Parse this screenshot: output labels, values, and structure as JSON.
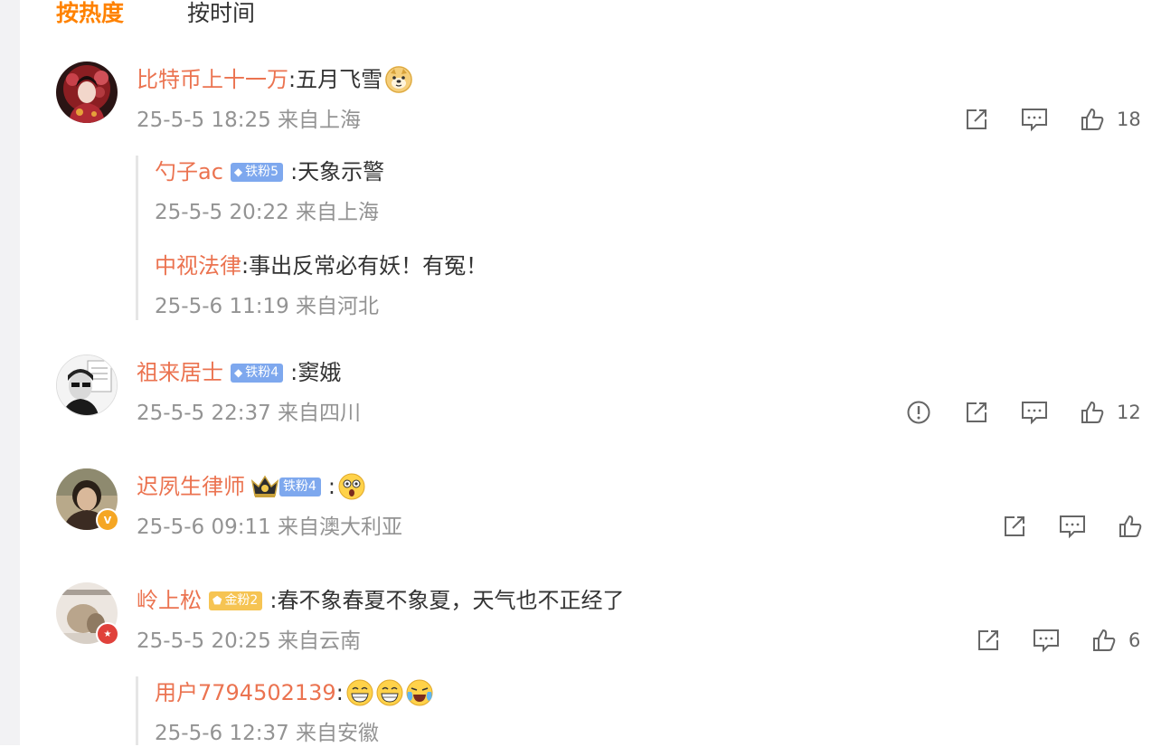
{
  "sort_tabs": {
    "hot": "按热度",
    "time": "按时间"
  },
  "colors": {
    "accent": "#ff8200",
    "username": "#eb7350",
    "meta": "#939393",
    "iron_badge": "#7ea8ee",
    "gold_badge": "#f6c453",
    "verified_orange": "#f5a623",
    "verified_red": "#e0413b"
  },
  "comments": [
    {
      "username": "比特币上十一万",
      "text": ":五月飞雪",
      "emoji": [
        "doge-emoji"
      ],
      "time": "25-5-5 18:25",
      "location": "来自上海",
      "likes": "18",
      "replies": [
        {
          "username": "勺子ac",
          "badge": "铁粉5",
          "text": ":天象示警",
          "time": "25-5-5 20:22",
          "location": "来自上海"
        },
        {
          "username": "中视法律",
          "text": ":事出反常必有妖！有冤！",
          "time": "25-5-6 11:19",
          "location": "来自河北"
        }
      ]
    },
    {
      "username": "祖来居士",
      "badge": "铁粉4",
      "text": ":窦娥",
      "time": "25-5-5 22:37",
      "location": "来自四川",
      "likes": "12"
    },
    {
      "username": "迟夙生律师",
      "badge": "铁粉4",
      "text": ":",
      "emoji": [
        "shocked-emoji"
      ],
      "time": "25-5-6 09:11",
      "location": "来自澳大利亚",
      "likes": ""
    },
    {
      "username": "岭上松",
      "badge": "金粉2",
      "text": ":春不象春夏不象夏，天气也不正经了",
      "time": "25-5-5 20:25",
      "location": "来自云南",
      "likes": "6",
      "replies": [
        {
          "username": "用户7794502139",
          "text": ":",
          "emoji": [
            "grin-emoji",
            "grin-emoji",
            "cry-laugh-emoji"
          ],
          "time": "25-5-6 12:37",
          "location": "来自安徽"
        }
      ]
    }
  ]
}
